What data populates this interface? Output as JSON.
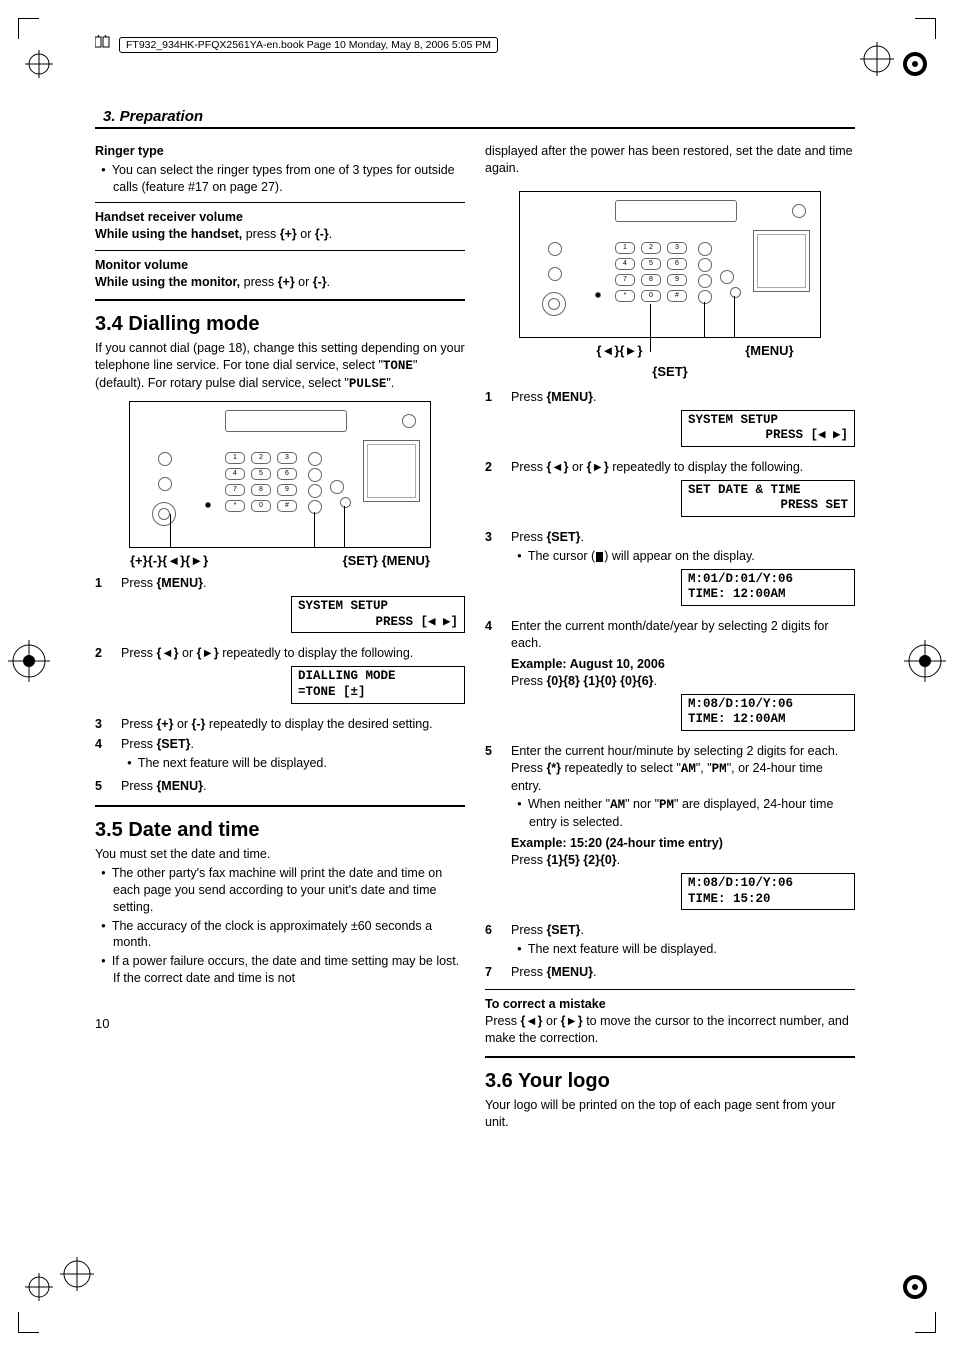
{
  "header": {
    "docline": "FT932_934HK-PFQX2561YA-en.book  Page 10  Monday, May 8, 2006  5:05 PM"
  },
  "section_title": "3. Preparation",
  "page_number": "10",
  "left": {
    "ringer_head": "Ringer type",
    "ringer_body": "You can select the ringer types from one of 3 types for outside calls (feature #17 on page 27).",
    "handset_head": "Handset receiver volume",
    "handset_body_a": "While using the handset,",
    "handset_body_b": " press {+} or {-}.",
    "monitor_head": "Monitor volume",
    "monitor_body_a": "While using the monitor,",
    "monitor_body_b": " press {+} or {-}.",
    "h34": "3.4 Dialling mode",
    "p34": "If you cannot dial (page 18), change this setting depending on your telephone line service. For tone dial service, select \"TONE\" (default). For rotary pulse dial service, select \"PULSE\".",
    "dev34_keys": "{+}{-}{◄}{►}",
    "dev34_right": "{SET} {MENU}",
    "s34": {
      "s1": "Press {MENU}.",
      "lcd1a": "SYSTEM SETUP",
      "lcd1b": "PRESS [◀ ▶]",
      "s2": "Press {◄} or {►} repeatedly to display the following.",
      "lcd2a": "DIALLING MODE",
      "lcd2b": "=TONE        [±]",
      "s3": "Press {+} or {-} repeatedly to display the desired setting.",
      "s4": "Press {SET}.",
      "s4b": "The next feature will be displayed.",
      "s5": "Press {MENU}."
    },
    "h35": "3.5 Date and time",
    "p35a": "You must set the date and time.",
    "p35_b1": "The other party's fax machine will print the date and time on each page you send according to your unit's date and time setting.",
    "p35_b2": "The accuracy of the clock is approximately ±60 seconds a month.",
    "p35_b3": "If a power failure occurs, the date and time setting may be lost. If the correct date and time is not"
  },
  "right": {
    "cont": "displayed after the power has been restored, set the date and time again.",
    "dev_left": "{◄}{►}",
    "dev_right": "{MENU}",
    "dev_center": "{SET}",
    "s35": {
      "s1": "Press {MENU}.",
      "lcd1a": "SYSTEM SETUP",
      "lcd1b": "PRESS [◀ ▶]",
      "s2": "Press {◄} or {►} repeatedly to display the following.",
      "lcd2a": "SET DATE & TIME",
      "lcd2b": "PRESS SET",
      "s3": "Press {SET}.",
      "s3b_a": "The cursor (",
      "s3b_b": ") will appear on the display.",
      "lcd3a": "M:01/D:01/Y:06",
      "lcd3b": "TIME: 12:00AM",
      "s4a": "Enter the current month/date/year by selecting 2 digits for each.",
      "s4_ex_h": "Example: August 10, 2006",
      "s4_ex_b": "Press {0}{8} {1}{0} {0}{6}.",
      "lcd4a": "M:08/D:10/Y:06",
      "lcd4b": "TIME: 12:00AM",
      "s5a": "Enter the current hour/minute by selecting 2 digits for each. Press {*} repeatedly to select \"AM\", \"PM\", or 24-hour time entry.",
      "s5b": "When neither \"AM\" nor \"PM\" are displayed, 24-hour time entry is selected.",
      "s5_ex_h": "Example: 15:20 (24-hour time entry)",
      "s5_ex_b": "Press {1}{5} {2}{0}.",
      "lcd5a": "M:08/D:10/Y:06",
      "lcd5b": "TIME: 15:20",
      "s6": "Press {SET}.",
      "s6b": "The next feature will be displayed.",
      "s7": "Press {MENU}."
    },
    "correct_h": "To correct a mistake",
    "correct_b": "Press {◄} or {►} to move the cursor to the incorrect number, and make the correction.",
    "h36": "3.6 Your logo",
    "p36": "Your logo will be printed on the top of each page sent from your unit."
  }
}
